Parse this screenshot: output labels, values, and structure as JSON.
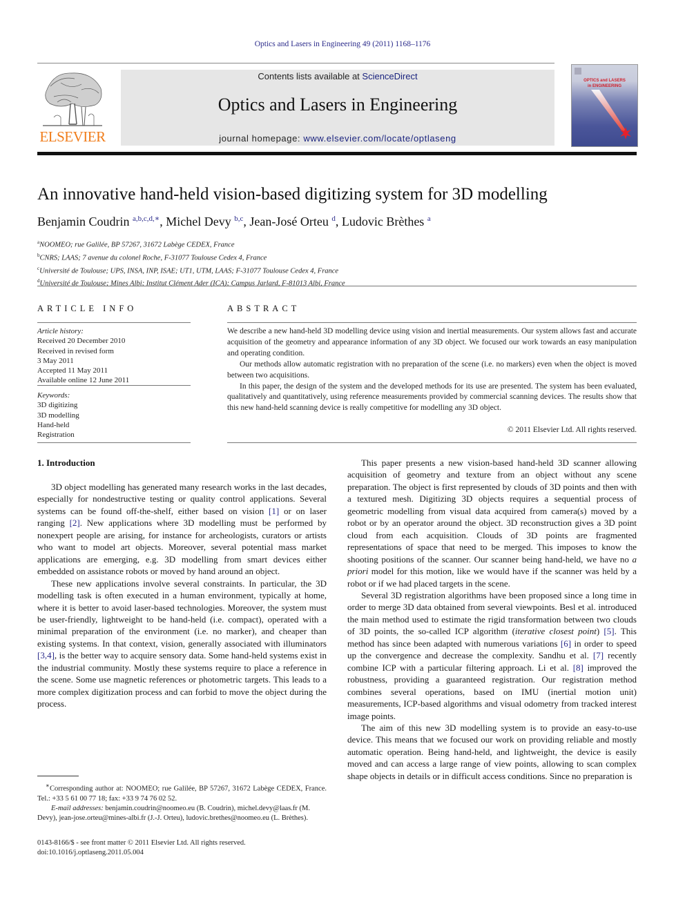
{
  "running_header": "Optics and Lasers in Engineering 49 (2011) 1168–1176",
  "masthead": {
    "publisher_logo": "ELSEVIER",
    "contents_prefix": "Contents lists available at ",
    "contents_link": "ScienceDirect",
    "journal_title": "Optics and Lasers in Engineering",
    "homepage_prefix": "journal homepage: ",
    "homepage_link": "www.elsevier.com/locate/optlaseng",
    "cover_title_line1": "OPTICS and LASERS",
    "cover_title_line2": "in ENGINEERING",
    "colors": {
      "elsevier_orange": "#f07c1a",
      "link_blue": "#1a237e",
      "masthead_gray": "#e6e6e6"
    }
  },
  "article": {
    "title": "An innovative hand-held vision-based digitizing system for 3D modelling",
    "authors": [
      {
        "name": "Benjamin Coudrin",
        "sup": "a,b,c,d,∗"
      },
      {
        "name": "Michel Devy",
        "sup": "b,c"
      },
      {
        "name": "Jean-José Orteu",
        "sup": "d"
      },
      {
        "name": "Ludovic Brèthes",
        "sup": "a"
      }
    ],
    "affiliations": [
      {
        "key": "a",
        "text": "NOOMEO; rue Galilée, BP 57267, 31672 Labège CEDEX, France"
      },
      {
        "key": "b",
        "text": "CNRS; LAAS; 7 avenue du colonel Roche, F-31077 Toulouse Cedex 4, France"
      },
      {
        "key": "c",
        "text": "Université de Toulouse; UPS, INSA, INP, ISAE; UT1, UTM, LAAS; F-31077 Toulouse Cedex 4, France"
      },
      {
        "key": "d",
        "text": "Université de Toulouse; Mines Albi; Institut Clément Ader (ICA); Campus Jarlard, F-81013 Albi, France"
      }
    ]
  },
  "article_info": {
    "heading": "ARTICLE INFO",
    "history_label": "Article history:",
    "history": [
      "Received 20 December 2010",
      "Received in revised form",
      "3 May 2011",
      "Accepted 11 May 2011",
      "Available online 12 June 2011"
    ],
    "keywords_label": "Keywords:",
    "keywords": [
      "3D digitizing",
      "3D modelling",
      "Hand-held",
      "Registration"
    ]
  },
  "abstract": {
    "heading": "ABSTRACT",
    "paragraphs": [
      "We describe a new hand-held 3D modelling device using vision and inertial measurements. Our system allows fast and accurate acquisition of the geometry and appearance information of any 3D object. We focused our work towards an easy manipulation and operating condition.",
      "Our methods allow automatic registration with no preparation of the scene (i.e. no markers) even when the object is moved between two acquisitions.",
      "In this paper, the design of the system and the developed methods for its use are presented. The system has been evaluated, qualitatively and quantitatively, using reference measurements provided by commercial scanning devices. The results show that this new hand-held scanning device is really competitive for modelling any 3D object."
    ],
    "copyright": "© 2011 Elsevier Ltd. All rights reserved."
  },
  "body": {
    "section_heading": "1.  Introduction",
    "left": {
      "p1": {
        "a": "3D object modelling has generated many research works in the last decades, especially for nondestructive testing or quality control applications. Several systems can be found off-the-shelf, either based on vision ",
        "ref1": "[1]",
        "b": " or on laser ranging ",
        "ref2": "[2]",
        "c": ". New applications where 3D modelling must be performed by nonexpert people are arising, for instance for archeologists, curators or artists who want to model art objects. Moreover, several potential mass market applications are emerging, e.g. 3D modelling from smart devices either embedded on assistance robots or moved by hand around an object."
      },
      "p2": {
        "a": "These new applications involve several constraints. In particular, the 3D modelling task is often executed in a human environment, typically at home, where it is better to avoid laser-based technologies. Moreover, the system must be user-friendly, lightweight to be hand-held (i.e. compact), operated with a minimal preparation of the environment (i.e. no marker), and cheaper than existing systems. In that context, vision, generally associated with illuminators ",
        "ref1": "[3,4]",
        "b": ", is the better way to acquire sensory data. Some hand-held systems exist in the industrial community. Mostly these systems require to place a reference in the scene. Some use magnetic references or photometric targets. This leads to a more complex digitization process and can forbid to move the object during the process."
      }
    },
    "right": {
      "p1": {
        "a": "This paper presents a new vision-based hand-held 3D scanner allowing acquisition of geometry and texture from an object without any scene preparation. The object is first represented by clouds of 3D points and then with a textured mesh. Digitizing 3D objects requires a sequential process of geometric modelling from visual data acquired from camera(s) moved by a robot or by an operator around the object. 3D reconstruction gives a 3D point cloud from each acquisition. Clouds of 3D points are fragmented representations of space that need to be merged. This imposes to know the shooting positions of the scanner. Our scanner being hand-held, we have no ",
        "ital": "a priori",
        "b": " model for this motion, like we would have if the scanner was held by a robot or if we had placed targets in the scene."
      },
      "p2": {
        "a": "Several 3D registration algorithms have been proposed since a long time in order to merge 3D data obtained from several viewpoints. Besl et al. introduced the main method used to estimate the rigid transformation between two clouds of 3D points, the so-called ICP algorithm (",
        "ital": "iterative closest point",
        "b": ") ",
        "ref1": "[5]",
        "c": ". This method has since been adapted with numerous variations ",
        "ref2": "[6]",
        "d": " in order to speed up the convergence and decrease the complexity. Sandhu et al. ",
        "ref3": "[7]",
        "e": " recently combine ICP with a particular filtering approach. Li et al. ",
        "ref4": "[8]",
        "f": " improved the robustness, providing a guaranteed registration. Our registration method combines several operations, based on IMU (inertial motion unit) measurements, ICP-based algorithms and visual odometry from tracked interest image points."
      },
      "p3": "The aim of this new 3D modelling system is to provide an easy-to-use device. This means that we focused our work on providing reliable and mostly automatic operation. Being hand-held, and lightweight, the device is easily moved and can access a large range of view points, allowing to scan complex shape objects in details or in difficult access conditions. Since no preparation is"
    }
  },
  "footnotes": {
    "corresponding_mark": "∗",
    "corresponding": "Corresponding author at: NOOMEO; rue Galilée, BP 57267, 31672 Labège CEDEX, France. Tel.: +33 5 61 00 77 18; fax: +33 9 74 76 02 52.",
    "email_label": "E-mail addresses:",
    "emails": " benjamin.coudrin@noomeo.eu (B. Coudrin), michel.devy@laas.fr (M. Devy), jean-jose.orteu@mines-albi.fr (J.-J. Orteu), ludovic.brethes@noomeo.eu (L. Brèthes).",
    "front_matter": "0143-8166/$ - see front matter © 2011 Elsevier Ltd. All rights reserved.",
    "doi": "doi:10.1016/j.optlaseng.2011.05.004"
  }
}
